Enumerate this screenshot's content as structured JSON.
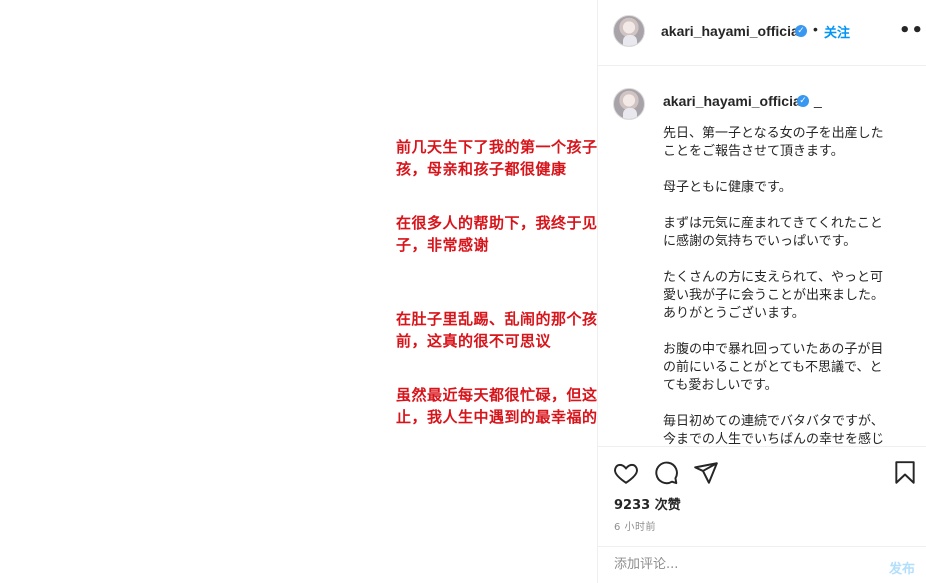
{
  "image_overlay": {
    "lines": [
      "前几天生下了我的第一个孩子，是女",
      "孩，母亲和孩子都很健康",
      "在很多人的帮助下，我终于见到了孩",
      "子，非常感谢",
      "在肚子里乱踢、乱闹的那个孩子就在眼",
      "前，这真的很不可思议",
      "虽然最近每天都很忙碌，但这是迄今为",
      "止，我人生中遇到的最幸福的事情。"
    ],
    "color": "#d8141b"
  },
  "header": {
    "username": "akari_hayami_official",
    "dot": "•",
    "follow_label": "关注",
    "more_label": "•••",
    "verified_icon": "✓"
  },
  "caption": {
    "username": "akari_hayami_official",
    "suffix": "_",
    "lines": [
      "先日、第一子となる女の子を出産した",
      "ことをご報告させて頂きます。",
      "母子ともに健康です。",
      "まずは元気に産まれてきてくれたこと",
      "に感謝の気持ちでいっぱいです。",
      "たくさんの方に支えられて、やっと可",
      "愛い我が子に会うことが出来ました。",
      "ありがとうございます。",
      "お腹の中で暴れ回っていたあの子が目",
      "の前にいることがとても不思議で、と",
      "ても愛おしいです。",
      "毎日初めての連続でバタバタですが、",
      "今までの人生でいちばんの幸せを感じ"
    ]
  },
  "actions": {
    "like_icon": "heart-icon",
    "comment_icon": "comment-icon",
    "share_icon": "share-icon",
    "save_icon": "bookmark-icon",
    "likes": "9233 次赞",
    "time": "6 小时前"
  },
  "comment": {
    "placeholder": "添加评论...",
    "post_label": "发布"
  },
  "colors": {
    "accent": "#0095f6",
    "post_disabled": "#b2dffc",
    "overlay_red": "#d8141b"
  }
}
